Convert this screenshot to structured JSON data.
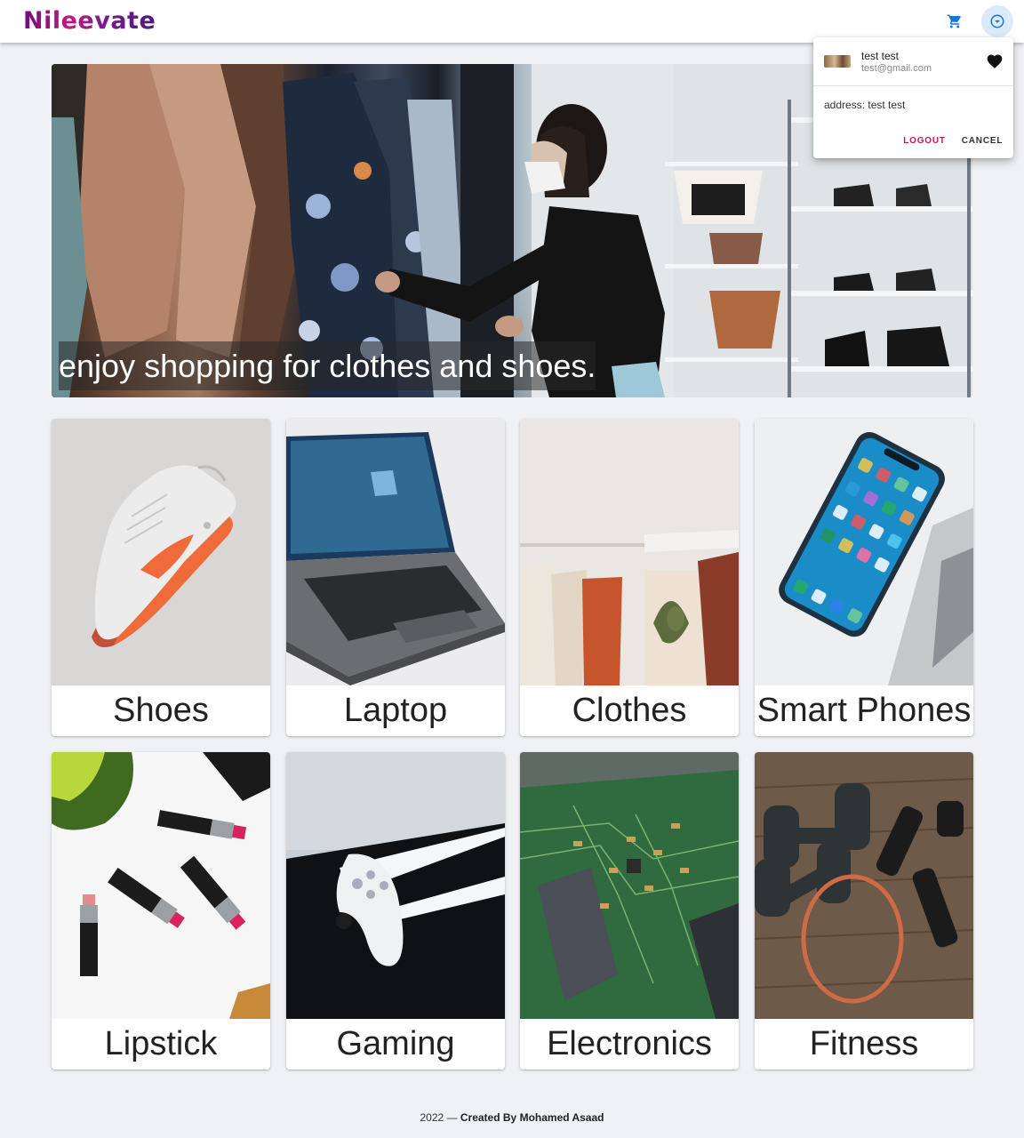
{
  "appbar": {
    "logo": "Nileevate",
    "cart_icon": "cart-icon",
    "account_icon": "chevron-circle-icon"
  },
  "account_menu": {
    "name": "test test",
    "email": "test@gmail.com",
    "favorite_icon": "heart-icon",
    "address": "address: test test",
    "logout_label": "LOGOUT",
    "cancel_label": "CANCEL"
  },
  "hero": {
    "caption": "enjoy shopping for clothes and shoes."
  },
  "categories": [
    {
      "label": "Shoes"
    },
    {
      "label": "Laptop"
    },
    {
      "label": "Clothes"
    },
    {
      "label": "Smart Phones"
    },
    {
      "label": "Lipstick"
    },
    {
      "label": "Gaming"
    },
    {
      "label": "Electronics"
    },
    {
      "label": "Fitness"
    }
  ],
  "footer": {
    "year": "2022",
    "separator": " — ",
    "credit": "Created By Mohamed Asaad"
  },
  "colors": {
    "brand": "#8e1a7f",
    "logout": "#c2185b",
    "account_button_bg": "#dbeaf8",
    "icon_blue": "#1976d2"
  }
}
